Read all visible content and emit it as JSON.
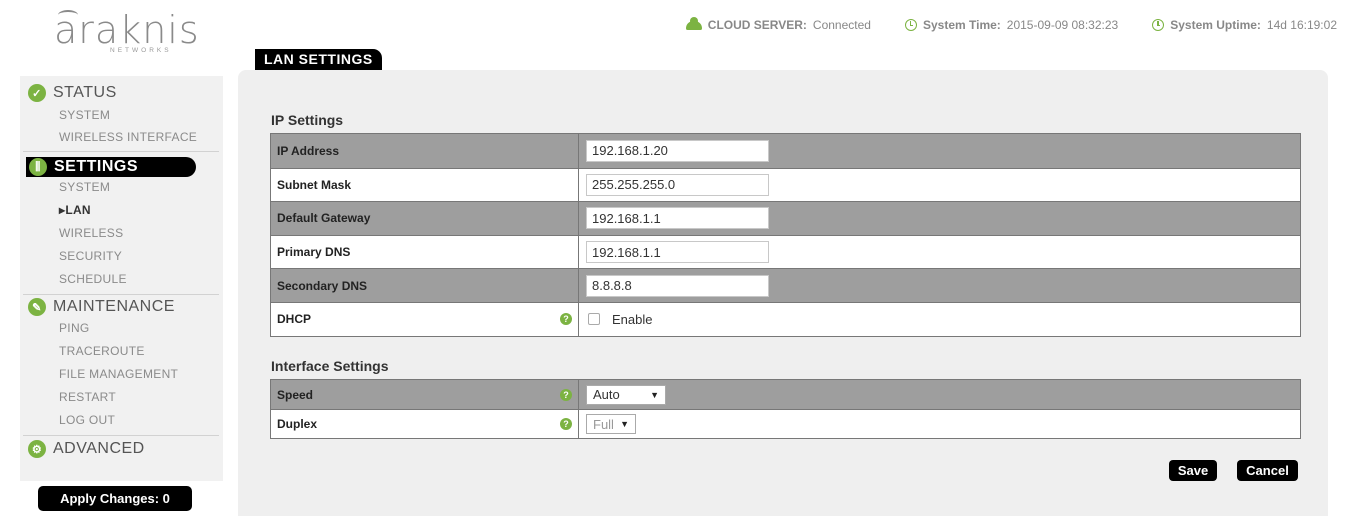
{
  "logo": {
    "word": "araknis",
    "sub": "NETWORKS"
  },
  "header": {
    "cloud_label": "CLOUD SERVER:",
    "cloud_value": "Connected",
    "time_label": "System Time:",
    "time_value": "2015-09-09 08:32:23",
    "uptime_label": "System Uptime:",
    "uptime_value": "14d 16:19:02"
  },
  "sidebar": {
    "status": {
      "label": "STATUS",
      "items": [
        "SYSTEM",
        "WIRELESS INTERFACE"
      ]
    },
    "settings": {
      "label": "SETTINGS",
      "items": [
        "SYSTEM",
        "▸LAN",
        "WIRELESS",
        "SECURITY",
        "SCHEDULE"
      ]
    },
    "maintenance": {
      "label": "MAINTENANCE",
      "items": [
        "PING",
        "TRACEROUTE",
        "FILE MANAGEMENT",
        "RESTART",
        "LOG OUT"
      ]
    },
    "advanced": {
      "label": "ADVANCED"
    },
    "apply_label": "Apply Changes: 0"
  },
  "page": {
    "tab": "LAN SETTINGS",
    "ip_section": "IP Settings",
    "interface_section": "Interface Settings",
    "save_label": "Save",
    "cancel_label": "Cancel"
  },
  "ip_settings": {
    "ip_address": {
      "label": "IP Address",
      "value": "192.168.1.20"
    },
    "subnet_mask": {
      "label": "Subnet Mask",
      "value": "255.255.255.0"
    },
    "default_gateway": {
      "label": "Default Gateway",
      "value": "192.168.1.1"
    },
    "primary_dns": {
      "label": "Primary DNS",
      "value": "192.168.1.1"
    },
    "secondary_dns": {
      "label": "Secondary DNS",
      "value": "8.8.8.8"
    },
    "dhcp": {
      "label": "DHCP",
      "option": "Enable",
      "checked": false
    }
  },
  "interface_settings": {
    "speed": {
      "label": "Speed",
      "value": "Auto"
    },
    "duplex": {
      "label": "Duplex",
      "value": "Full"
    }
  },
  "colors": {
    "accent": "#7cb342",
    "dark_row": "#9e9e9e",
    "panel": "#efefef"
  }
}
